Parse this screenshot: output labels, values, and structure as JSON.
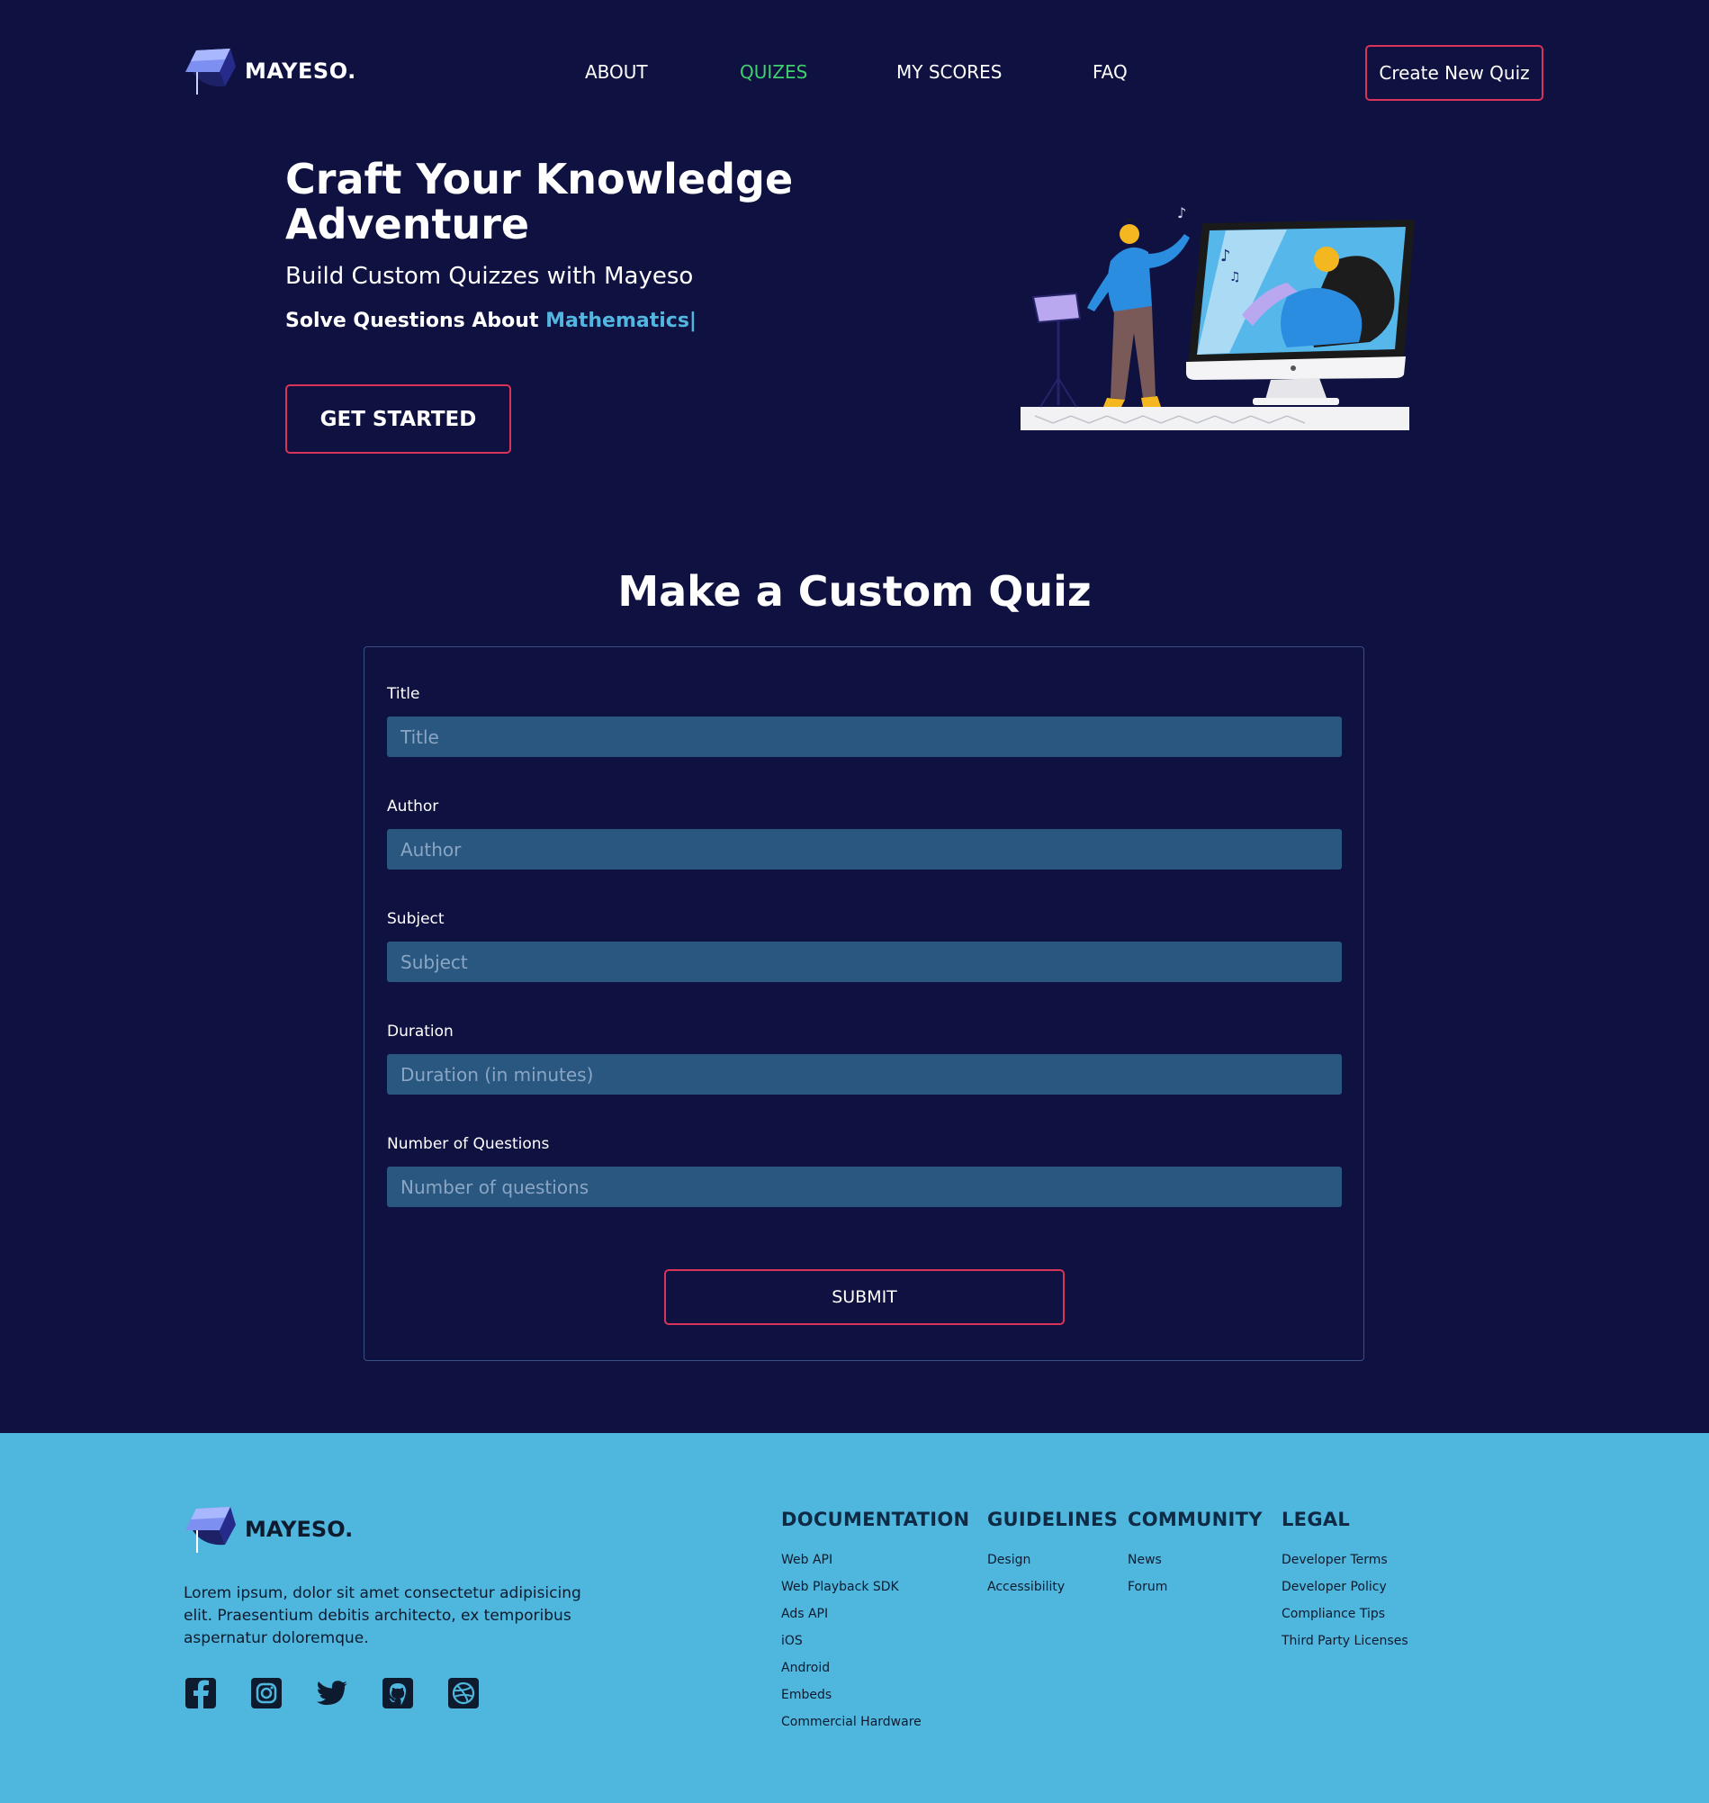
{
  "brand": {
    "name": "MAYESO."
  },
  "nav": {
    "links": [
      {
        "label": "ABOUT"
      },
      {
        "label": "QUIZES",
        "active": true
      },
      {
        "label": "MY SCORES"
      },
      {
        "label": "FAQ"
      }
    ],
    "create_button": "Create New Quiz"
  },
  "hero": {
    "title_line1": "Craft Your Knowledge",
    "title_line2": "Adventure",
    "subtitle": "Build Custom Quizzes with Mayeso",
    "solve_prefix": "Solve Questions About ",
    "solve_topic": "Mathematics|",
    "cta": "GET STARTED",
    "illustration": "person-singing-with-computer-illustration"
  },
  "form": {
    "heading": "Make a Custom Quiz",
    "fields": [
      {
        "label": "Title",
        "placeholder": "Title"
      },
      {
        "label": "Author",
        "placeholder": "Author"
      },
      {
        "label": "Subject",
        "placeholder": "Subject"
      },
      {
        "label": "Duration",
        "placeholder": "Duration (in minutes)"
      },
      {
        "label": "Number of Questions",
        "placeholder": "Number of questions"
      }
    ],
    "submit": "SUBMIT"
  },
  "footer": {
    "brand": "MAYESO.",
    "description": "Lorem ipsum, dolor sit amet consectetur adipisicing elit. Praesentium debitis architecto, ex temporibus aspernatur doloremque.",
    "socials": [
      "facebook-icon",
      "instagram-icon",
      "twitter-icon",
      "github-icon",
      "dribbble-icon"
    ],
    "columns": [
      {
        "title": "DOCUMENTATION",
        "items": [
          "Web API",
          "Web Playback SDK",
          "Ads API",
          "iOS",
          "Android",
          "Embeds",
          "Commercial Hardware"
        ]
      },
      {
        "title": "GUIDELINES",
        "items": [
          "Design",
          "Accessibility"
        ]
      },
      {
        "title": "COMMUNITY",
        "items": [
          "News",
          "Forum"
        ]
      },
      {
        "title": "LEGAL",
        "items": [
          "Developer Terms",
          "Developer Policy",
          "Compliance Tips",
          "Third Party Licenses"
        ]
      }
    ]
  },
  "colors": {
    "background": "#0f1140",
    "accent_green": "#3fcf6e",
    "accent_blue": "#53b6e0",
    "button_border": "#d9335a",
    "input_bg": "#2a5780",
    "footer_bg": "#4fb6de"
  }
}
